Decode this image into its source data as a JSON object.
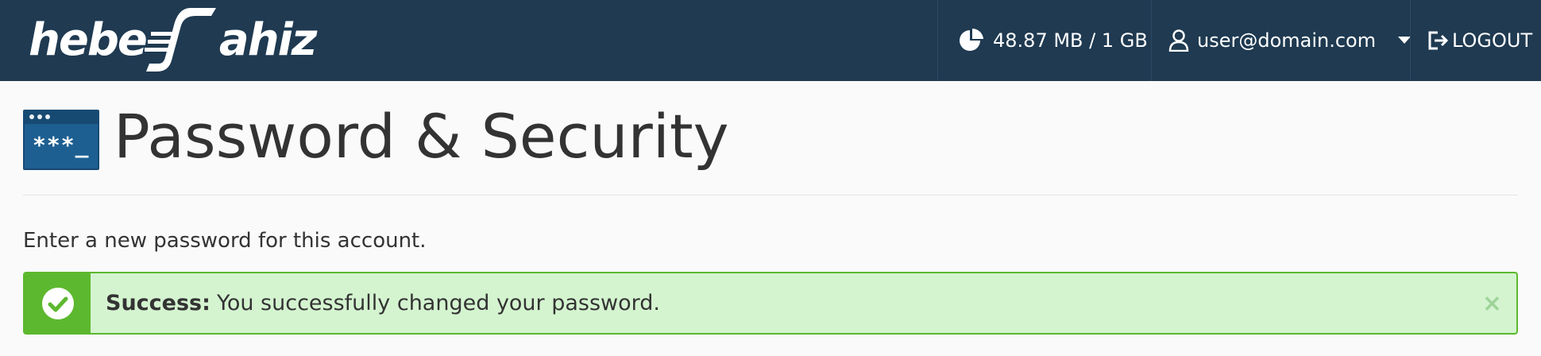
{
  "brand": {
    "left": "hebe",
    "right": "ahiz"
  },
  "nav": {
    "usage": "48.87 MB / 1 GB",
    "user": "user@domain.com",
    "logout": "LOGOUT"
  },
  "page": {
    "title": "Password & Security",
    "icon_text": "***_",
    "instruction": "Enter a new password for this account."
  },
  "alert": {
    "label": "Success:",
    "message": "You successfully changed your password.",
    "close": "×"
  },
  "colors": {
    "topbar": "#1f3a51",
    "alert_bg": "#d4f4d0",
    "alert_accent": "#5cb82e",
    "page_icon": "#1e5f92"
  }
}
